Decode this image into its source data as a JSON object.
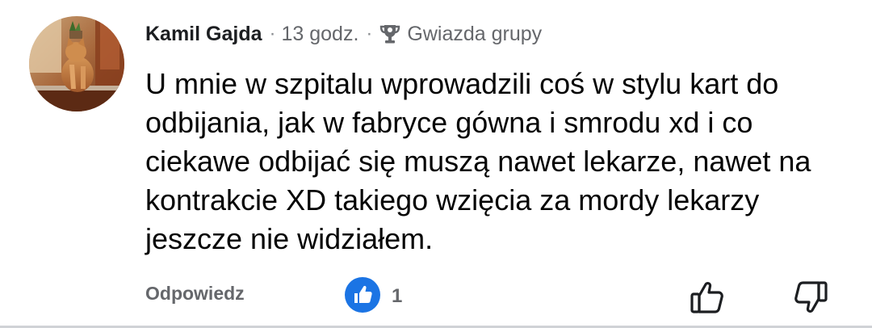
{
  "comment": {
    "author": "Kamil Gajda",
    "separator": "·",
    "time": "13 godz.",
    "badge_label": "Gwiazda grupy",
    "badge_icon": "trophy-icon",
    "text_lines": [
      "U mnie w szpitalu wprowadzili coś w stylu kart do",
      "odbijania, jak w fabryce gówna i smrodu xd i co",
      "ciekawe odbijać się muszą nawet lekarze, nawet na",
      "kontrakcie XD takiego wzięcia za mordy lekarzy",
      "jeszcze nie widziałem."
    ]
  },
  "actions": {
    "reply_label": "Odpowiedz",
    "like_count": "1",
    "like_icon": "like-icon",
    "upvote_icon": "thumb-up-icon",
    "downvote_icon": "thumb-down-icon"
  },
  "colors": {
    "like_blue": "#1b74e4",
    "meta_grey": "#65676b",
    "text": "#050505"
  }
}
